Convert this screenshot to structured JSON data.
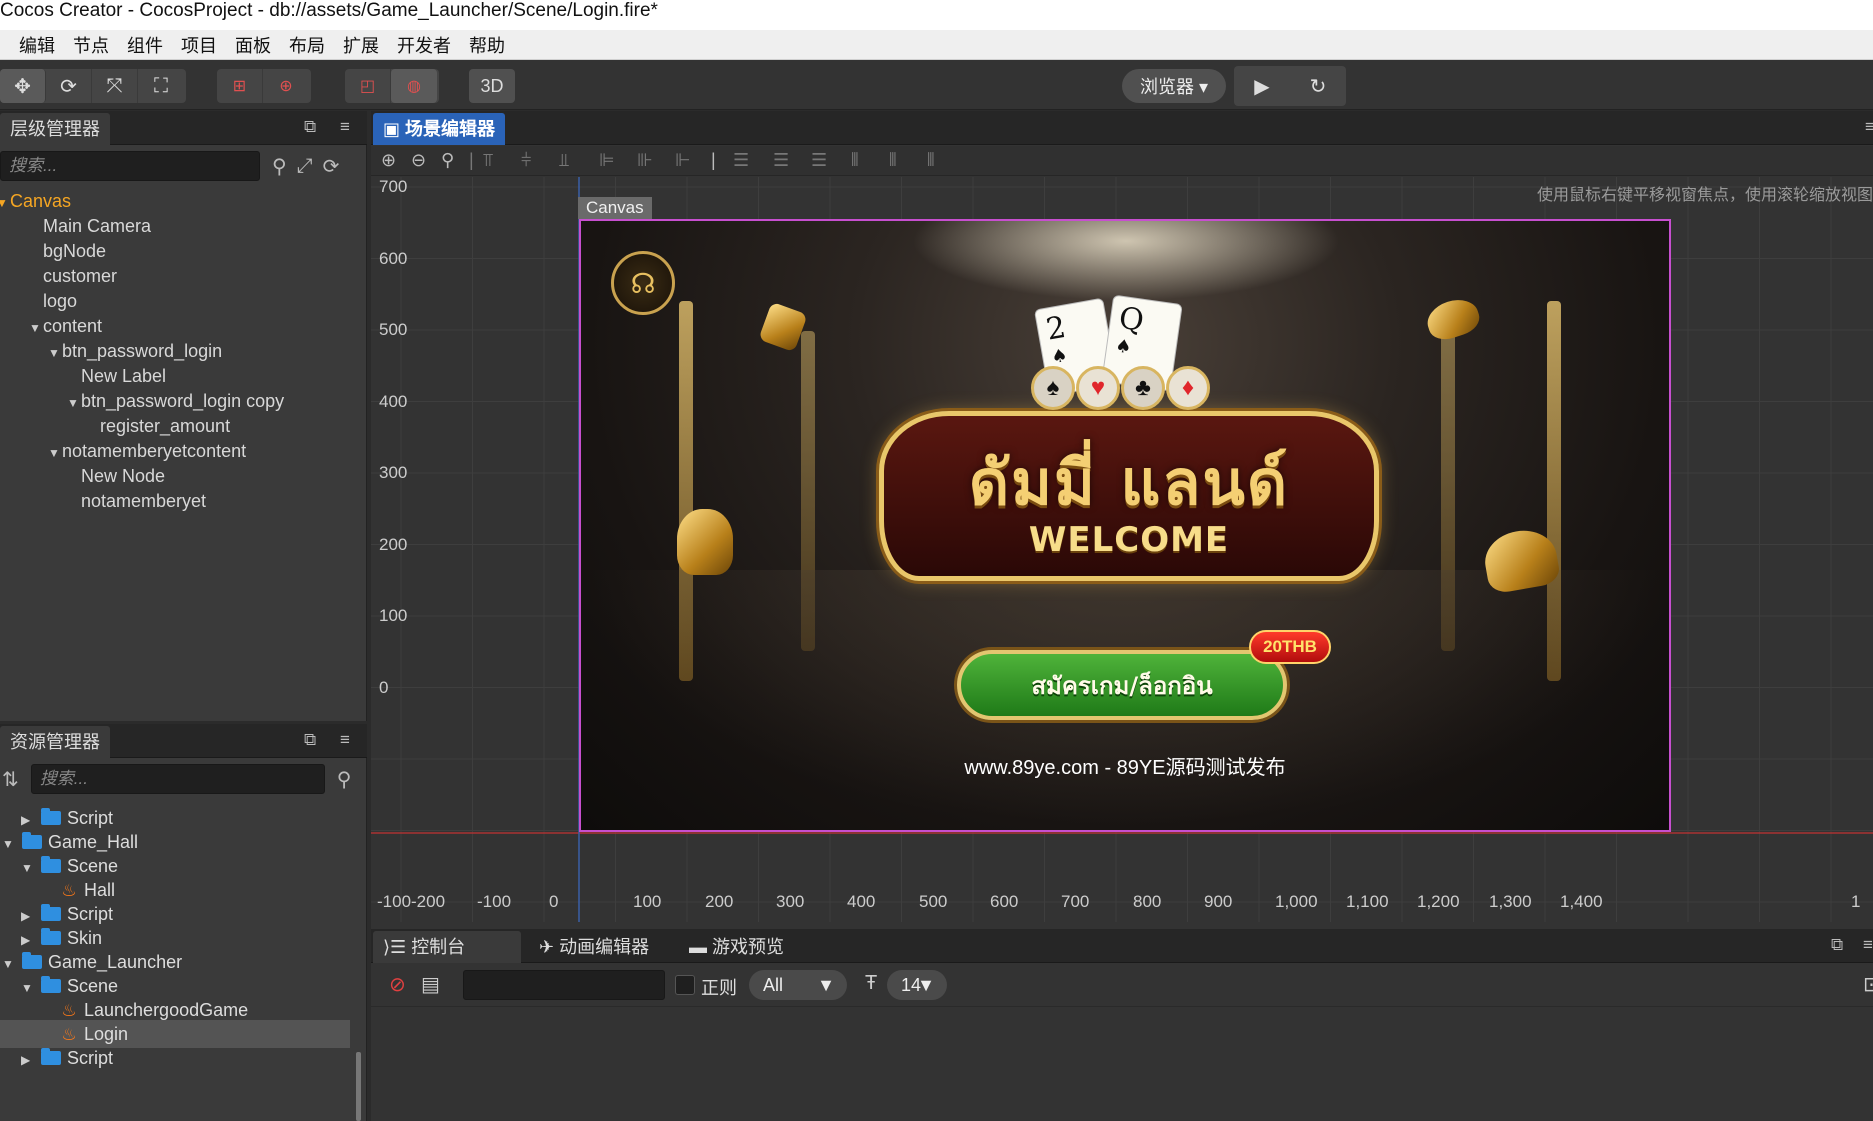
{
  "window": {
    "title": "Cocos Creator - CocosProject - db://assets/Game_Launcher/Scene/Login.fire*"
  },
  "menu": [
    "编辑",
    "节点",
    "组件",
    "项目",
    "面板",
    "布局",
    "扩展",
    "开发者",
    "帮助"
  ],
  "toolbar": {
    "mode_3d": "3D",
    "browser": "浏览器 ▾",
    "play_icon": "▶",
    "refresh_icon": "↻"
  },
  "hierarchy": {
    "tab": "层级管理器",
    "search_placeholder": "搜索...",
    "nodes": [
      {
        "label": "Canvas",
        "depth": 0,
        "expanded": true,
        "root": true
      },
      {
        "label": "Main Camera",
        "depth": 1
      },
      {
        "label": "bgNode",
        "depth": 1
      },
      {
        "label": "customer",
        "depth": 1
      },
      {
        "label": "logo",
        "depth": 1
      },
      {
        "label": "content",
        "depth": 1,
        "expanded": true
      },
      {
        "label": "btn_password_login",
        "depth": 2,
        "expanded": true
      },
      {
        "label": "New Label",
        "depth": 3
      },
      {
        "label": "btn_password_login copy",
        "depth": 3,
        "expanded": true
      },
      {
        "label": "register_amount",
        "depth": 4
      },
      {
        "label": "notamemberyetcontent",
        "depth": 2,
        "expanded": true
      },
      {
        "label": "New Node",
        "depth": 3
      },
      {
        "label": "notamemberyet",
        "depth": 3
      }
    ]
  },
  "assets": {
    "tab": "资源管理器",
    "search_placeholder": "搜索...",
    "items": [
      {
        "label": "Script",
        "depth": 1,
        "kind": "folder",
        "arrow": "right"
      },
      {
        "label": "Game_Hall",
        "depth": 0,
        "kind": "folder",
        "arrow": "down"
      },
      {
        "label": "Scene",
        "depth": 1,
        "kind": "folder",
        "arrow": "down"
      },
      {
        "label": "Hall",
        "depth": 2,
        "kind": "scene"
      },
      {
        "label": "Script",
        "depth": 1,
        "kind": "folder",
        "arrow": "right"
      },
      {
        "label": "Skin",
        "depth": 1,
        "kind": "folder",
        "arrow": "right"
      },
      {
        "label": "Game_Launcher",
        "depth": 0,
        "kind": "folder",
        "arrow": "down"
      },
      {
        "label": "Scene",
        "depth": 1,
        "kind": "folder",
        "arrow": "down"
      },
      {
        "label": "LaunchergoodGame",
        "depth": 2,
        "kind": "scene"
      },
      {
        "label": "Login",
        "depth": 2,
        "kind": "scene",
        "selected": true
      },
      {
        "label": "Script",
        "depth": 1,
        "kind": "folder",
        "arrow": "right"
      }
    ]
  },
  "scene_editor": {
    "tab": "场景编辑器",
    "hint": "使用鼠标右键平移视窗焦点，使用滚轮缩放视图",
    "canvas_label": "Canvas",
    "y_ticks": [
      "700",
      "600",
      "500",
      "400",
      "300",
      "200",
      "100",
      "0"
    ],
    "x_ticks": [
      "-100-200",
      "-100",
      "0",
      "100",
      "200",
      "300",
      "400",
      "500",
      "600",
      "700",
      "800",
      "900",
      "1,000",
      "1,100",
      "1,200",
      "1,300",
      "1,400",
      "1"
    ]
  },
  "game": {
    "title": "ดัมมี่ แลนด์",
    "subtitle": "WELCOME",
    "card_left": "2",
    "card_right": "Q",
    "login_button": "สมัครเกม/ล็อกอิน",
    "badge": "20THB",
    "site": "www.89ye.com - 89YE源码测试发布",
    "colors": {
      "button_green": "#2e9a22",
      "gold": "#e9c76a",
      "badge_red": "#d81b1b"
    }
  },
  "console": {
    "tabs": [
      "控制台",
      "动画编辑器",
      "游戏预览"
    ],
    "regex_label": "正则",
    "level": "All",
    "font_size": "14"
  }
}
